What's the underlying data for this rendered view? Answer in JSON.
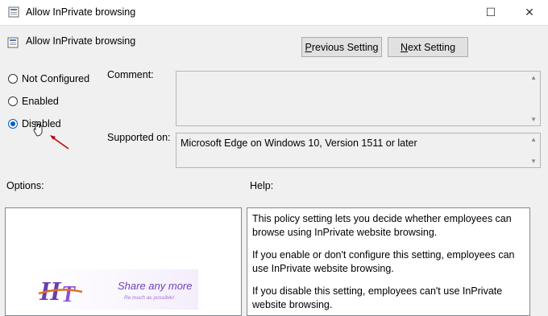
{
  "window": {
    "title": "Allow InPrivate browsing",
    "maximize_glyph": "☐",
    "close_glyph": "✕"
  },
  "policy": {
    "title": "Allow InPrivate browsing"
  },
  "buttons": {
    "previous_label_u": "P",
    "previous_label_rest": "revious Setting",
    "next_label_u": "N",
    "next_label_rest": "ext Setting"
  },
  "state": {
    "options": [
      {
        "label": "Not Configured",
        "selected": false
      },
      {
        "label": "Enabled",
        "selected": false
      },
      {
        "label": "Disabled",
        "selected": true
      }
    ]
  },
  "comment": {
    "label": "Comment:",
    "value": ""
  },
  "supported": {
    "label": "Supported on:",
    "value": "Microsoft Edge on Windows 10, Version 1511 or later"
  },
  "options_panel": {
    "label": "Options:"
  },
  "help_panel": {
    "label": "Help:",
    "paragraphs": [
      "This policy setting lets you decide whether employees can browse using InPrivate website browsing.",
      "If you enable or don't configure this setting, employees can use InPrivate website browsing.",
      "If you disable this setting, employees can't use InPrivate website browsing."
    ]
  },
  "watermark": {
    "logo_text": "H.T",
    "tagline": "Share any more",
    "subline": "Re much as possible!"
  },
  "colors": {
    "accent": "#0060c0",
    "annotation_arrow": "#c00000"
  }
}
